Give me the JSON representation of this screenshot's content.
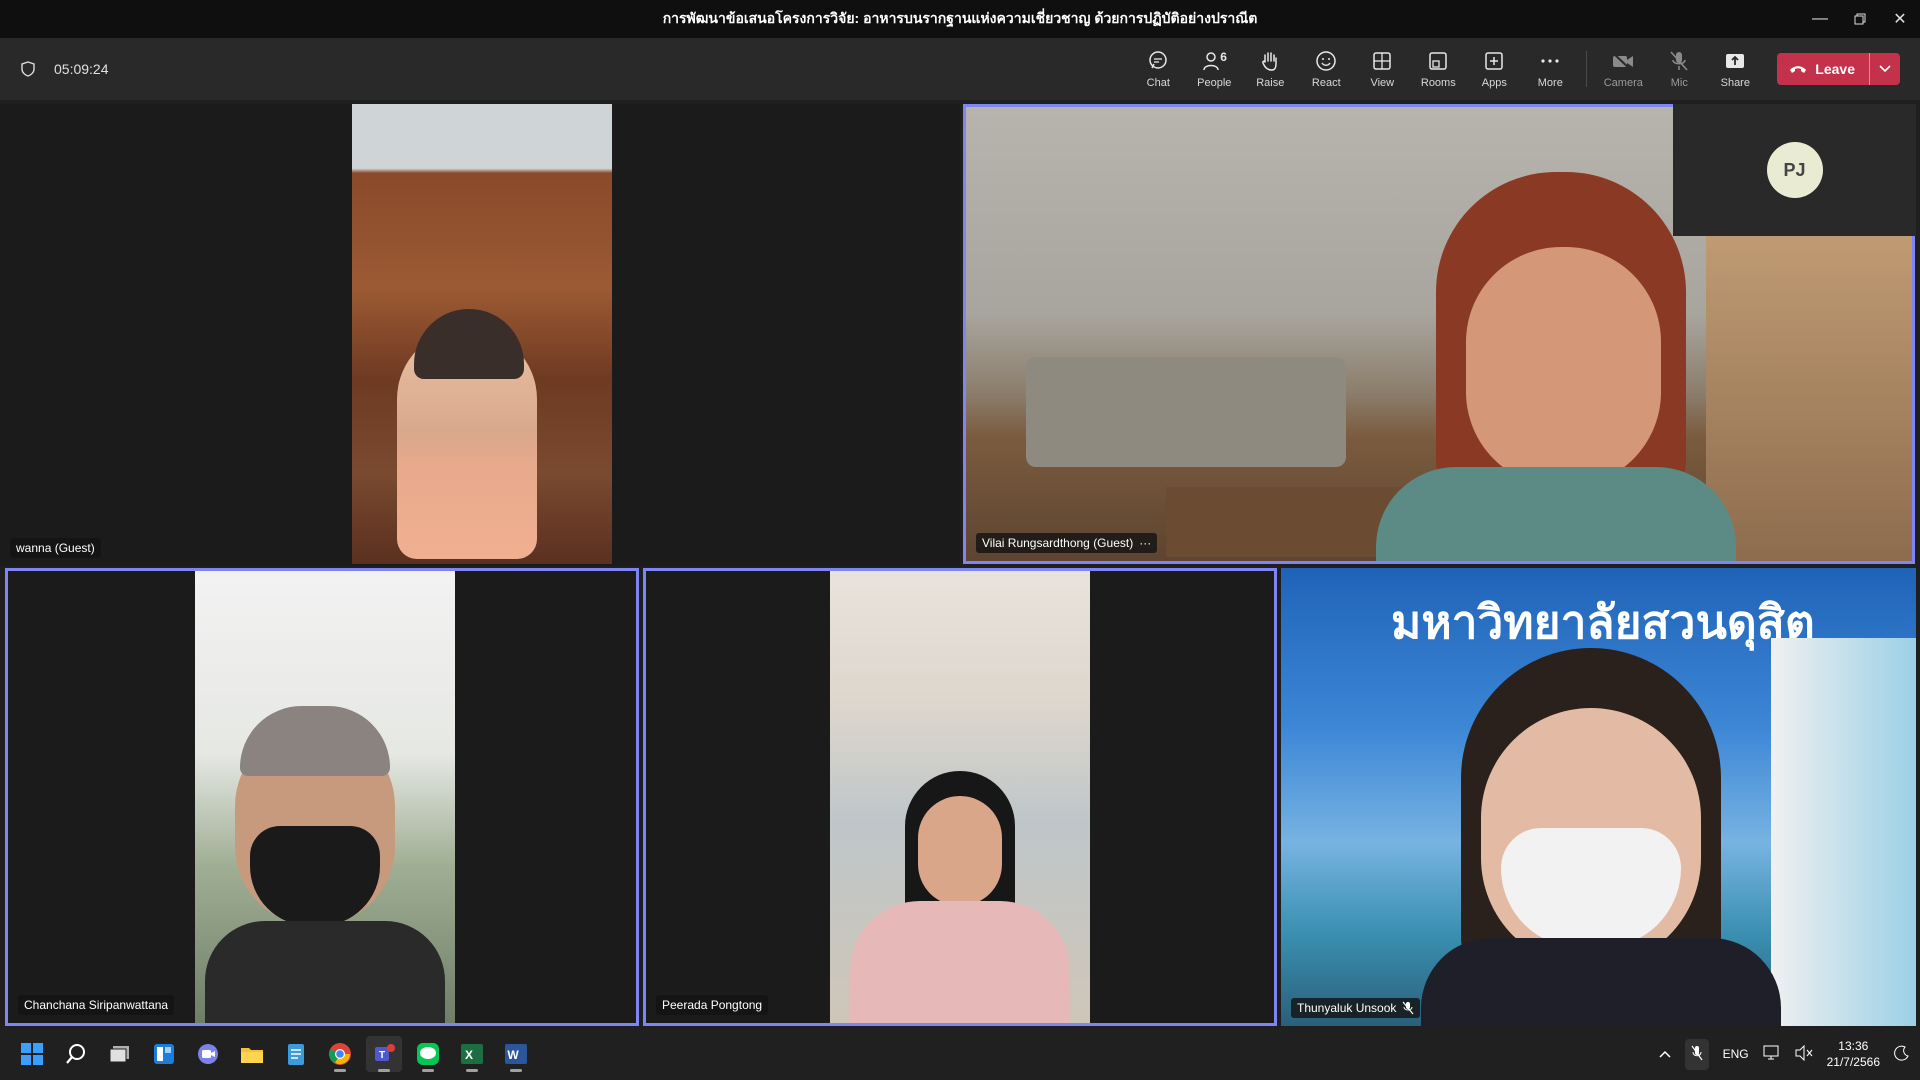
{
  "window": {
    "title": "การพัฒนาข้อเสนอโครงการวิจัย: อาหารบนรากฐานแห่งความเชี่ยวชาญ ด้วยการปฏิบัติอย่างปราณีต"
  },
  "meeting": {
    "elapsed": "05:09:24",
    "toolbar": {
      "chat": "Chat",
      "people": "People",
      "people_count": "6",
      "raise": "Raise",
      "react": "React",
      "view": "View",
      "rooms": "Rooms",
      "apps": "Apps",
      "more": "More",
      "camera": "Camera",
      "mic": "Mic",
      "share": "Share",
      "leave": "Leave"
    }
  },
  "participants": [
    {
      "name": "wanna (Guest)"
    },
    {
      "name": "Vilai Rungsardthong (Guest)"
    },
    {
      "name": "Chanchana Siripanwattana"
    },
    {
      "name": "Peerada Pongtong"
    },
    {
      "name": "Thunyaluk Unsook"
    }
  ],
  "self_view": {
    "initials": "PJ"
  },
  "background_sign": "มหาวิทยาลัยสวนดุสิต",
  "taskbar": {
    "language": "ENG",
    "time": "13:36",
    "date": "21/7/2566"
  },
  "colors": {
    "leave": "#c4314b",
    "active_border": "#7f85f5",
    "titlebar": "#0f0f0f",
    "toolbar": "#292929"
  }
}
